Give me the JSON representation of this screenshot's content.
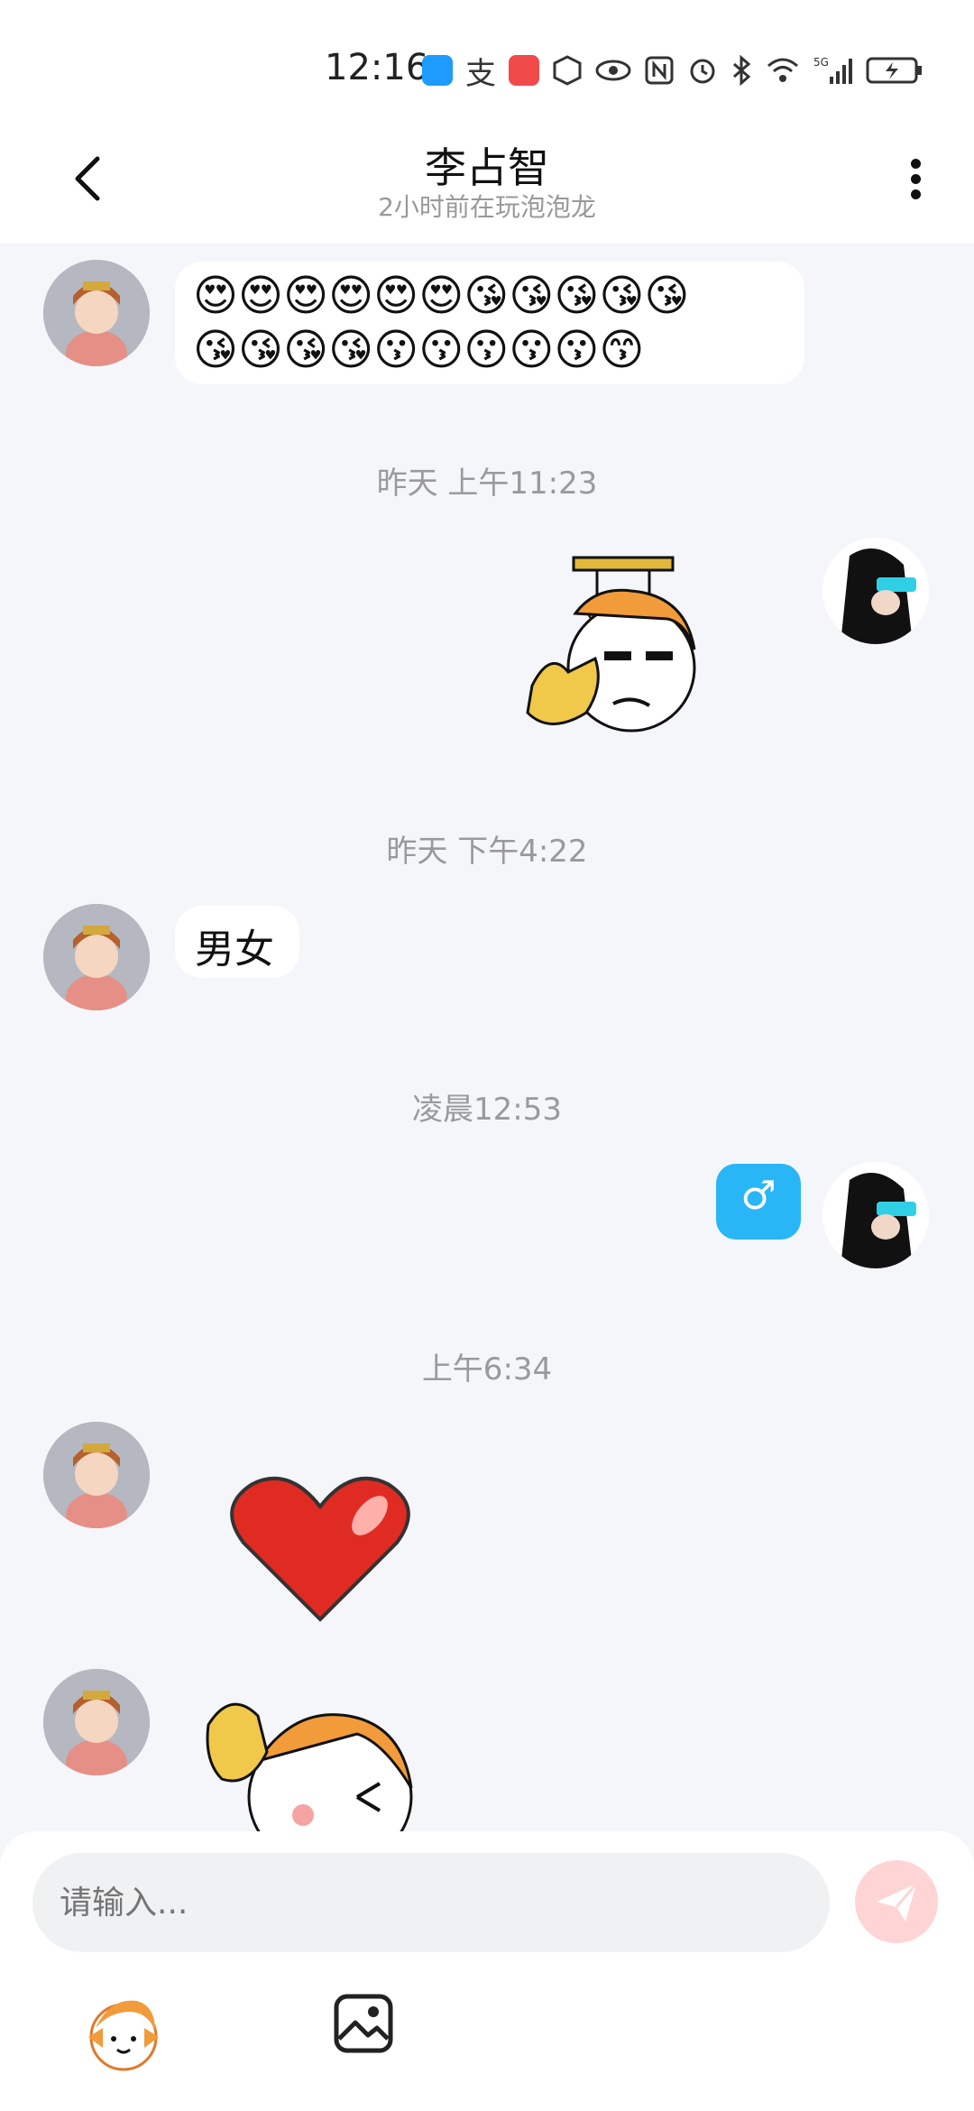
{
  "status_bar": {
    "time": "12:16",
    "icons": [
      "search-app-icon",
      "alipay-icon",
      "book-app-icon",
      "hand-icon",
      "eye-icon",
      "nfc-icon",
      "alarm-icon",
      "bluetooth-icon",
      "wifi-icon",
      "signal-5g-icon",
      "battery-charging-icon"
    ]
  },
  "header": {
    "back_label": "back",
    "title": "李占智",
    "subtitle": "2小时前在玩泡泡龙",
    "more_label": "more"
  },
  "messages": {
    "m1": {
      "row1": "😍😍😍😍😍😍😘😘😘😘😘",
      "row2": "😘😘😘😘😗😗😗😗😗😙"
    },
    "ts1": "昨天 上午11:23",
    "ts2": "昨天 下午4:22",
    "m3": "男女",
    "ts3": "凌晨12:53",
    "m4": "♂",
    "ts4": "上午6:34"
  },
  "composer": {
    "placeholder": "请输入...",
    "send_label": "send"
  },
  "colors": {
    "accent_blue": "#29b6f6",
    "send_button": "#ffd4d4",
    "background": "#f4f6fa"
  }
}
